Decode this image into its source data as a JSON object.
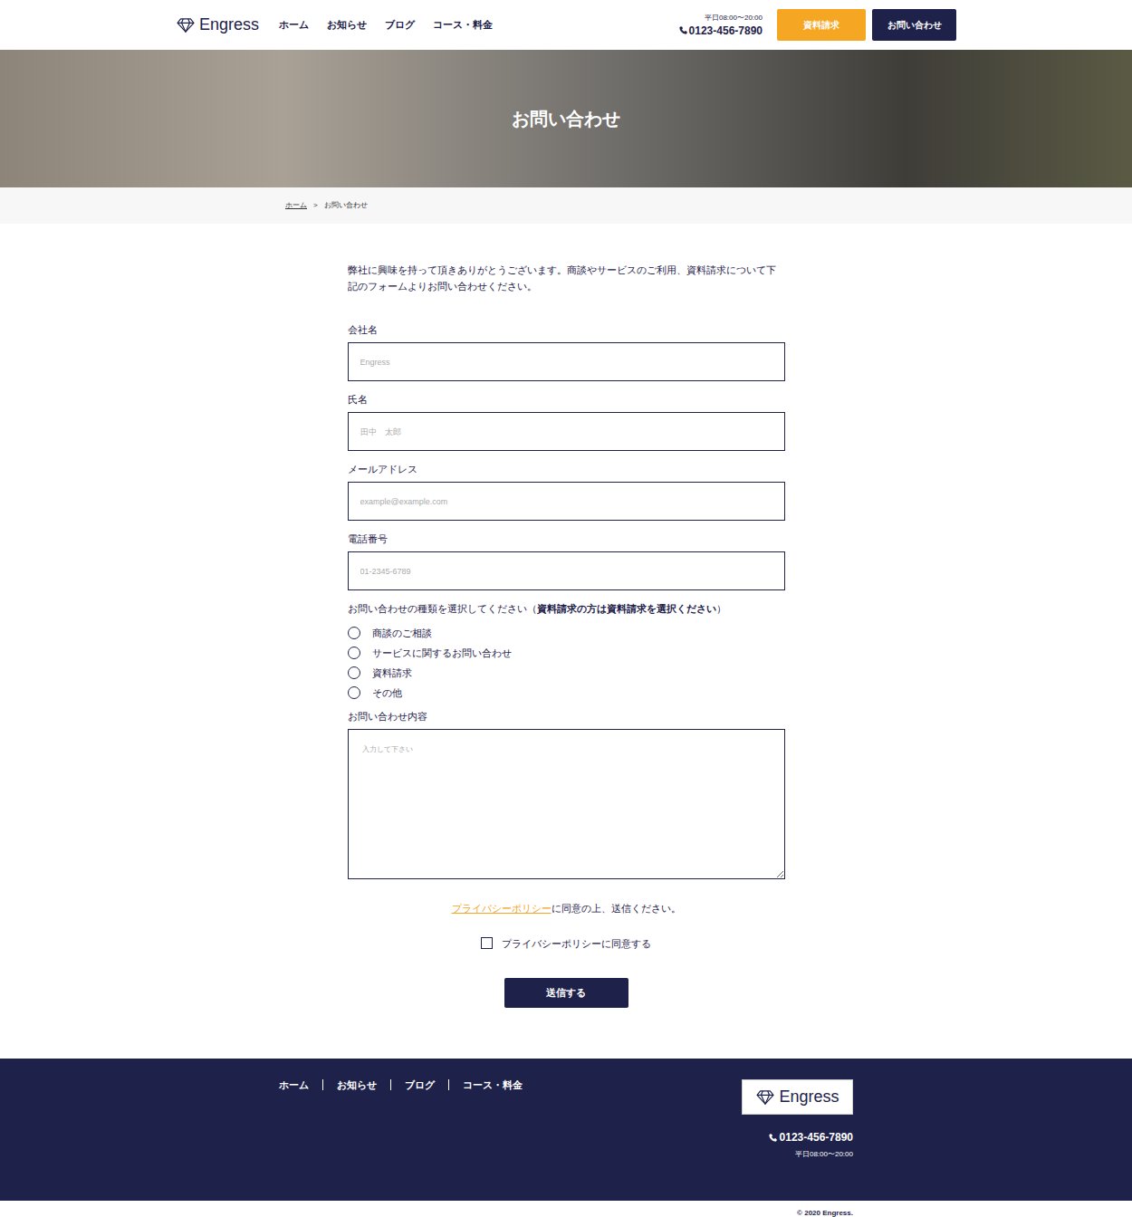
{
  "header": {
    "logo": "Engress",
    "nav": [
      "ホーム",
      "お知らせ",
      "ブログ",
      "コース・料金"
    ],
    "hours": "平日08:00〜20:00",
    "phone": "0123-456-7890",
    "request_button": "資料請求",
    "contact_button": "お問い合わせ"
  },
  "hero": {
    "title": "お問い合わせ"
  },
  "breadcrumb": {
    "items": [
      "ホーム",
      "お問い合わせ"
    ],
    "separator": ">"
  },
  "intro": "弊社に興味を持って頂きありがとうございます。商談やサービスのご利用、資料請求について下記のフォームよりお問い合わせください。",
  "fields": [
    {
      "label": "会社名",
      "placeholder": "Engress"
    },
    {
      "label": "氏名",
      "placeholder": "田中　太郎"
    },
    {
      "label": "メールアドレス",
      "placeholder": "example@example.com"
    },
    {
      "label": "電話番号",
      "placeholder": "01-2345-6789"
    }
  ],
  "inquiry_type": {
    "label": "お問い合わせの種類を選択してください（",
    "label_bold": "資料請求の方は資料請求を選択ください",
    "label_end": "）",
    "options": [
      {
        "label": "商談のご相談",
        "selected": false
      },
      {
        "label": "サービスに関するお問い合わせ",
        "selected": false
      },
      {
        "label": "資料請求",
        "selected": false
      },
      {
        "label": "その他",
        "selected": false
      }
    ]
  },
  "message": {
    "label": "お問い合わせ内容",
    "placeholder": "入力して下さい"
  },
  "privacy": {
    "link": "プライバシーポリシー",
    "text": "に同意の上、送信ください。",
    "checkbox_label": "プライバシーポリシーに同意する",
    "checked": false
  },
  "submit": "送信する",
  "footer": {
    "nav": [
      "ホーム",
      "お知らせ",
      "ブログ",
      "コース・料金"
    ],
    "logo": "Engress",
    "phone": "0123-456-7890",
    "hours": "平日08:00〜20:00",
    "copyright": "© 2020 Engress."
  }
}
